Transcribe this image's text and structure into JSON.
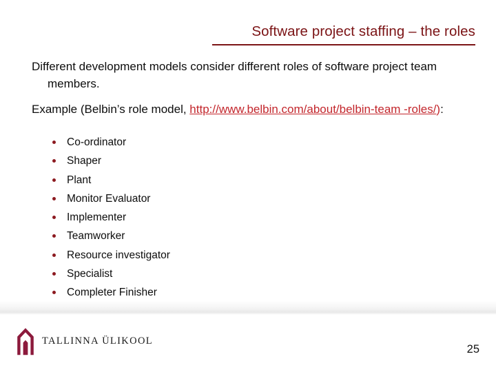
{
  "slide": {
    "title": "Software project staffing – the roles",
    "accent_color": "#7b1315",
    "link_color": "#c3262c",
    "bullet_color": "#8c1a20",
    "body": {
      "paragraph_1": "Different development models consider different roles of software project team members.",
      "paragraph_2_prefix": "Example (Belbin’s role model, ",
      "paragraph_2_url": "http://www.belbin.com/about/belbin-team -roles/",
      "paragraph_2_close_paren": ")",
      "paragraph_2_suffix": ":"
    },
    "roles": [
      {
        "label": "Co-ordinator"
      },
      {
        "label": "Shaper"
      },
      {
        "label": "Plant"
      },
      {
        "label": "Monitor Evaluator"
      },
      {
        "label": "Implementer"
      },
      {
        "label": "Teamworker"
      },
      {
        "label": "Resource investigator"
      },
      {
        "label": "Specialist"
      },
      {
        "label": "Completer Finisher"
      }
    ],
    "footer": {
      "logo_text": "TALLINNA ÜLIKOOL",
      "logo_icon": "arch-gateway-icon",
      "page_number": "25"
    }
  }
}
